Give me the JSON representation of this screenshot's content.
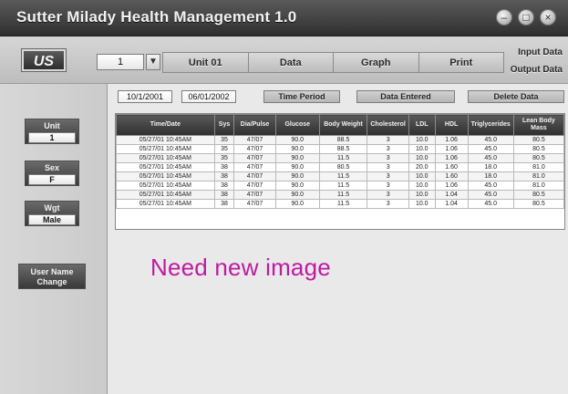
{
  "window": {
    "title": "Sutter Milady Health Management 1.0",
    "controls": {
      "minimize": "–",
      "maximize": "□",
      "close": "×"
    }
  },
  "toolbar": {
    "logo_text": "US",
    "user_value": "1",
    "dropdown_symbol": "▼",
    "nav": [
      "Unit 01",
      "Data",
      "Graph",
      "Print"
    ],
    "input_data_label": "Input Data",
    "output_data_label": "Output Data"
  },
  "left_panel": {
    "boxes": [
      {
        "label": "Unit",
        "value": "1"
      },
      {
        "label": "Sex",
        "value": "F"
      },
      {
        "label": "Wgt",
        "value": "Male"
      }
    ],
    "change_button": "User Name Change"
  },
  "filters": {
    "start_date": "10/1/2001",
    "end_date": "06/01/2002",
    "buttons": [
      "Time Period",
      "Data Entered",
      "Delete Data"
    ]
  },
  "table": {
    "headers": [
      "Time/Date",
      "Sys",
      "Dia/Pulse",
      "Glucose",
      "Body Weight",
      "Cholesterol",
      "LDL",
      "HDL",
      "Triglycerides",
      "Lean Body Mass"
    ],
    "rows": [
      [
        "05/27/01 10:45AM",
        "35",
        "47/07",
        "90.0",
        "88.5",
        "3",
        "10.0",
        "1.06",
        "45.0",
        "80.5"
      ],
      [
        "05/27/01 10:45AM",
        "35",
        "47/07",
        "90.0",
        "88.5",
        "3",
        "10.0",
        "1.06",
        "45.0",
        "80.5"
      ],
      [
        "05/27/01 10:45AM",
        "35",
        "47/07",
        "90.0",
        "11.5",
        "3",
        "10.0",
        "1.06",
        "45.0",
        "80.5"
      ],
      [
        "05/27/01 10:45AM",
        "38",
        "47/07",
        "90.0",
        "80.5",
        "3",
        "20.0",
        "1.60",
        "18.0",
        "81.0"
      ],
      [
        "05/27/01 10:45AM",
        "38",
        "47/07",
        "90.0",
        "11.5",
        "3",
        "10.0",
        "1.60",
        "18.0",
        "81.0"
      ],
      [
        "05/27/01 10:45AM",
        "38",
        "47/07",
        "90.0",
        "11.5",
        "3",
        "10.0",
        "1.06",
        "45.0",
        "81.0"
      ],
      [
        "05/27/01 10:45AM",
        "38",
        "47/07",
        "90.0",
        "11.5",
        "3",
        "10.0",
        "1.04",
        "45.0",
        "80.5"
      ],
      [
        "05/27/01 10:45AM",
        "38",
        "47/07",
        "90.0",
        "11.5",
        "3",
        "10.0",
        "1.04",
        "45.0",
        "80.5"
      ]
    ]
  },
  "placeholder_text": "Need new image",
  "colors": {
    "accent": "#bf1aa1",
    "header": "#3f3f3f"
  }
}
